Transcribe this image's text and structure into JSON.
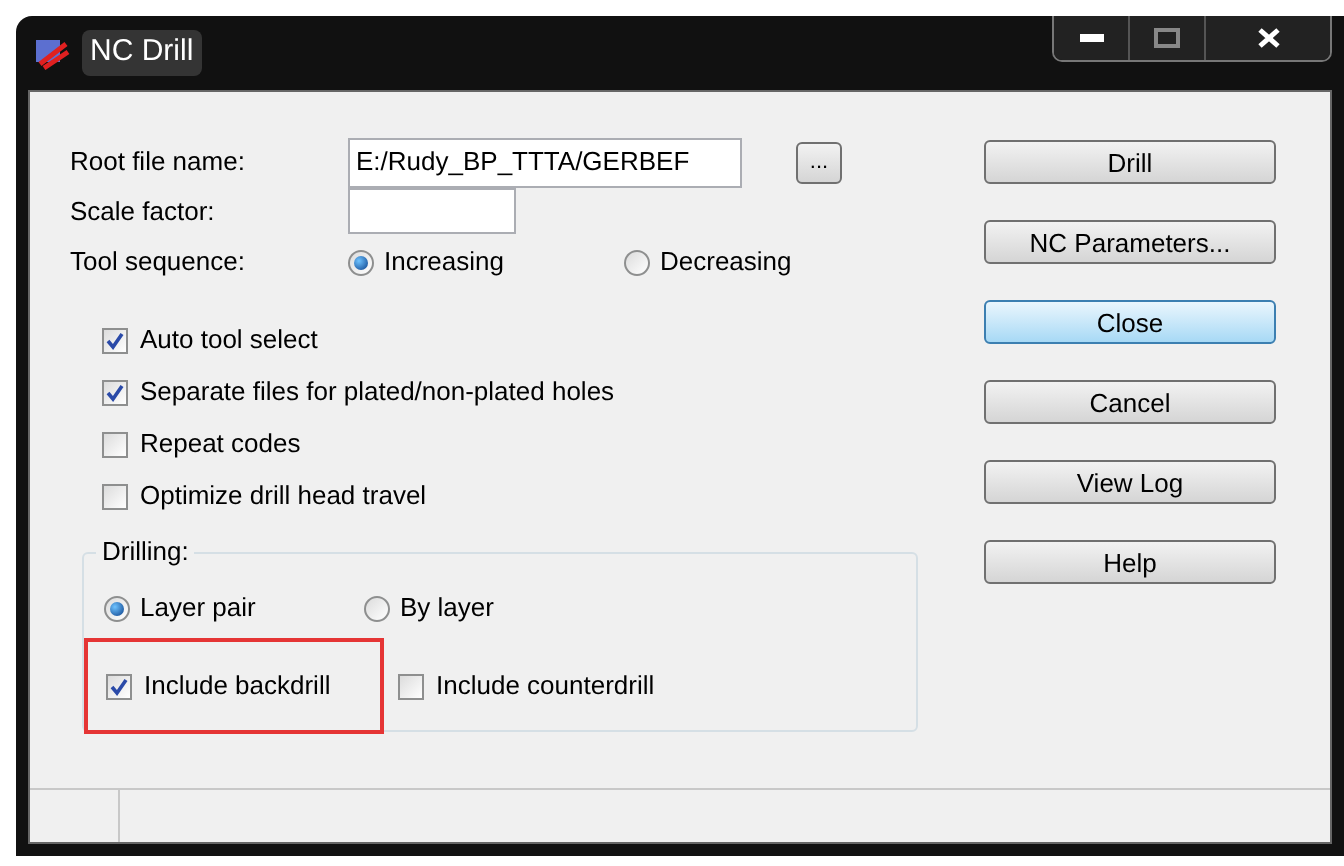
{
  "window": {
    "title": "NC Drill"
  },
  "root_file_name": {
    "label": "Root file name:",
    "value": "E:/Rudy_BP_TTTA/GERBEF"
  },
  "browse_button": "...",
  "scale_factor": {
    "label": "Scale factor:"
  },
  "tool_sequence": {
    "label": "Tool sequence:",
    "options": [
      {
        "label": "Increasing",
        "selected": true
      },
      {
        "label": "Decreasing",
        "selected": false
      }
    ]
  },
  "options": [
    {
      "label": "Auto tool select",
      "checked": true
    },
    {
      "label": "Separate files for plated/non-plated holes",
      "checked": true
    },
    {
      "label": "Repeat codes",
      "checked": false
    },
    {
      "label": "Optimize drill head travel",
      "checked": false
    }
  ],
  "drilling": {
    "title": "Drilling:",
    "modes": [
      {
        "label": "Layer pair",
        "selected": true
      },
      {
        "label": "By layer",
        "selected": false
      }
    ],
    "includes": [
      {
        "label": "Include backdrill",
        "checked": true,
        "highlighted": true
      },
      {
        "label": "Include counterdrill",
        "checked": false,
        "highlighted": false
      }
    ]
  },
  "buttons": [
    {
      "label": "Drill",
      "focused": false
    },
    {
      "label": "NC Parameters...",
      "focused": false
    },
    {
      "label": "Close",
      "focused": true
    },
    {
      "label": "Cancel",
      "focused": false
    },
    {
      "label": "View Log",
      "focused": false
    },
    {
      "label": "Help",
      "focused": false
    }
  ]
}
